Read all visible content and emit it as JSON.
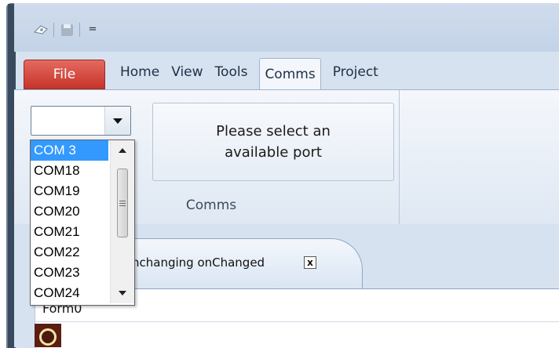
{
  "quick_access": {
    "icons": [
      "ribbon-logo-icon",
      "save-icon",
      "customize-dropdown-icon"
    ],
    "dropdown_glyph": "="
  },
  "tabs": [
    {
      "label": "File",
      "active": false
    },
    {
      "label": "Home",
      "active": false
    },
    {
      "label": "View",
      "active": false
    },
    {
      "label": "Tools",
      "active": false
    },
    {
      "label": "Comms",
      "active": true
    },
    {
      "label": "Project",
      "active": false
    }
  ],
  "comms_group": {
    "label": "Comms",
    "port_combo_value": "",
    "select_button_line1": "Please select an",
    "select_button_line2": "available port"
  },
  "port_list": {
    "items": [
      "COM 3",
      "COM18",
      "COM19",
      "COM20",
      "COM21",
      "COM22",
      "COM23",
      "COM24"
    ],
    "selected_index": 0
  },
  "document": {
    "tab_label": "nchanging onChanged",
    "close_glyph": "x",
    "form_label": "Form0"
  },
  "colors": {
    "file_tab": "#c7332a",
    "selection": "#3399ff",
    "ribbon_bg": "#dfe8f3"
  }
}
